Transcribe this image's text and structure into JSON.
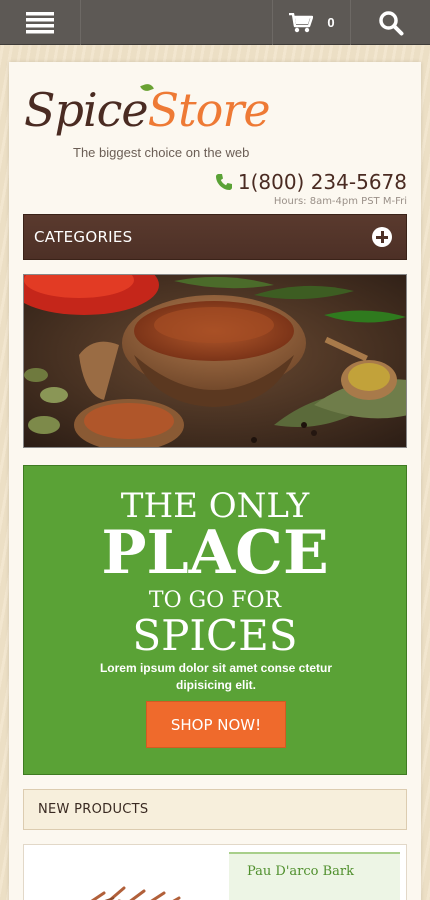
{
  "topbar": {
    "menu_icon": "menu-icon",
    "cart_icon": "cart-icon",
    "cart_count": "0",
    "search_icon": "search-icon"
  },
  "header": {
    "logo_part1": "Spice",
    "logo_part2": "Store",
    "tagline": "The biggest choice on the web",
    "phone": "1(800) 234-5678",
    "hours": "Hours: 8am-4pm PST M-Fri"
  },
  "categories": {
    "label": "CATEGORIES",
    "icon": "plus-circle-icon"
  },
  "promo": {
    "line1": "THE ONLY",
    "line2": "PLACE",
    "line3": "TO GO FOR",
    "line4": "SPICES",
    "text": "Lorem ipsum dolor sit amet conse ctetur dipisicing elit.",
    "button": "SHOP NOW!"
  },
  "new_products": {
    "label": "NEW PRODUCTS",
    "items": [
      {
        "name": "Pau D'arco Bark"
      }
    ]
  },
  "colors": {
    "topbar": "#5d5955",
    "brand_brown": "#4a2b22",
    "brand_orange": "#ee7a35",
    "promo_green": "#5aa236",
    "button_orange": "#ef6a2c"
  }
}
